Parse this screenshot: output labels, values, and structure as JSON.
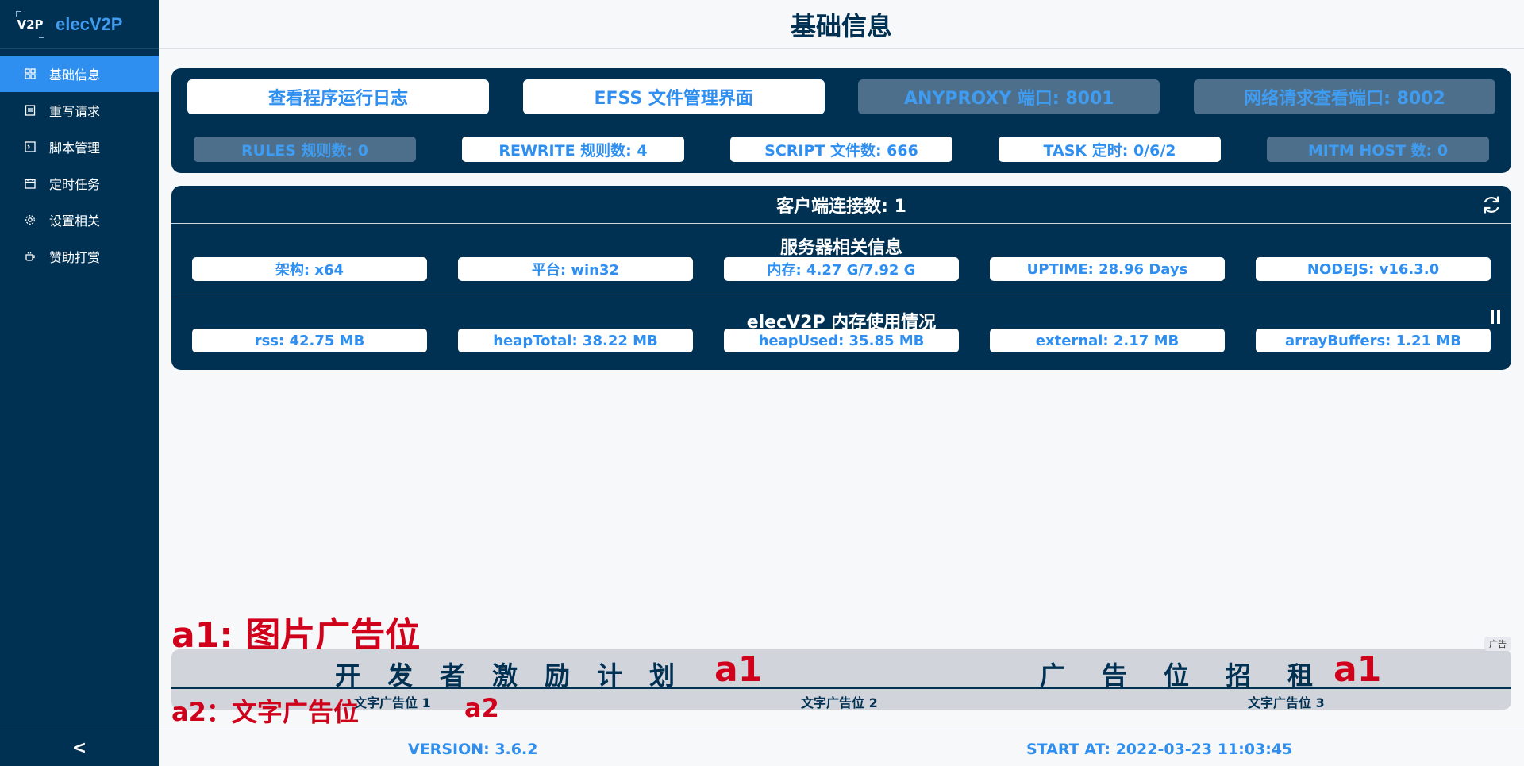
{
  "app": {
    "logo_text": "V2P",
    "name": "elecV2P"
  },
  "sidebar": {
    "items": [
      {
        "label": "基础信息",
        "icon": "dashboard-icon"
      },
      {
        "label": "重写请求",
        "icon": "document-icon"
      },
      {
        "label": "脚本管理",
        "icon": "terminal-icon"
      },
      {
        "label": "定时任务",
        "icon": "calendar-icon"
      },
      {
        "label": "设置相关",
        "icon": "gear-icon"
      },
      {
        "label": "赞助打赏",
        "icon": "coffee-icon"
      }
    ],
    "collapse_label": "<"
  },
  "header": {
    "title": "基础信息"
  },
  "top_buttons": {
    "log": "查看程序运行日志",
    "efss": "EFSS 文件管理界面",
    "anyproxy": "ANYPROXY 端口: 8001",
    "network": "网络请求查看端口: 8002"
  },
  "stats": {
    "rules": "RULES 规则数: 0",
    "rewrite": "REWRITE 规则数: 4",
    "script": "SCRIPT 文件数: 666",
    "task": "TASK 定时: 0/6/2",
    "mitm": "MITM HOST 数: 0"
  },
  "client": {
    "label": "客户端连接数: 1"
  },
  "server": {
    "title": "服务器相关信息",
    "arch": "架构: x64",
    "platform": "平台: win32",
    "memory": "内存: 4.27 G/7.92 G",
    "uptime": "UPTIME: 28.96 Days",
    "nodejs": "NODEJS: v16.3.0"
  },
  "memory_usage": {
    "title": "elecV2P 内存使用情况",
    "rss": "rss: 42.75 MB",
    "heap_total": "heapTotal: 38.22 MB",
    "heap_used": "heapUsed: 35.85 MB",
    "external": "external: 2.17 MB",
    "array_buffers": "arrayBuffers: 1.21 MB"
  },
  "ads": {
    "a1_label": "a1: 图片广告位",
    "image_ad_left": "开发者激励计划",
    "image_ad_right": "广告位招租",
    "a1_mark": "a1",
    "badge": "广告",
    "text_ad_1": "文字广告位 1",
    "text_ad_2": "文字广告位 2",
    "text_ad_3": "文字广告位 3",
    "a2_label": "a2：文字广告位",
    "a2_mark": "a2"
  },
  "footer": {
    "version": "VERSION: 3.6.2",
    "start_at": "START AT: 2022-03-23 11:03:45"
  },
  "colors": {
    "sidebar_bg": "#003153",
    "accent": "#2f8ff0",
    "ad_red": "#d0021b"
  }
}
